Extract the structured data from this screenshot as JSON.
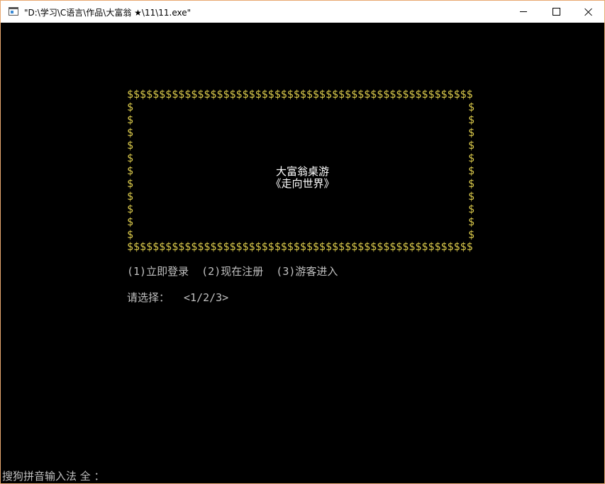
{
  "window": {
    "title": "\"D:\\学习\\C语言\\作品\\大富翁 ★\\11\\11.exe\"",
    "controls": {
      "minimize": "minimize",
      "maximize": "maximize",
      "close": "close"
    }
  },
  "console": {
    "border_top": "$$$$$$$$$$$$$$$$$$$$$$$$$$$$$$$$$$$$$$$$$$$$$$$$$$$$$$$$$$$$$$$$$$$$$$$$$$$$$$$$$$$$$",
    "border_bottom": "$$$$$$$$$$$$$$$$$$$$$$$$$$$$$$$$$$$$$$$$$$$$$$$$$$$$$$$$$$$$$$$$$$$$$$$$$$$$$$$$$$$$$",
    "border_side": "$\n$\n$\n$\n$\n$\n$\n$\n$\n$\n$",
    "game_title": "大富翁桌游",
    "game_subtitle": "《走向世界》",
    "menu": "(1)立即登录  (2)现在注册  (3)游客进入",
    "prompt_label": "请选择：",
    "prompt_options": "<1/2/3>",
    "ime_status": "搜狗拼音输入法 全 ："
  },
  "colors": {
    "border": "#d9c84a",
    "text": "#c0c0c0",
    "title": "#ffffff",
    "background": "#000000"
  }
}
